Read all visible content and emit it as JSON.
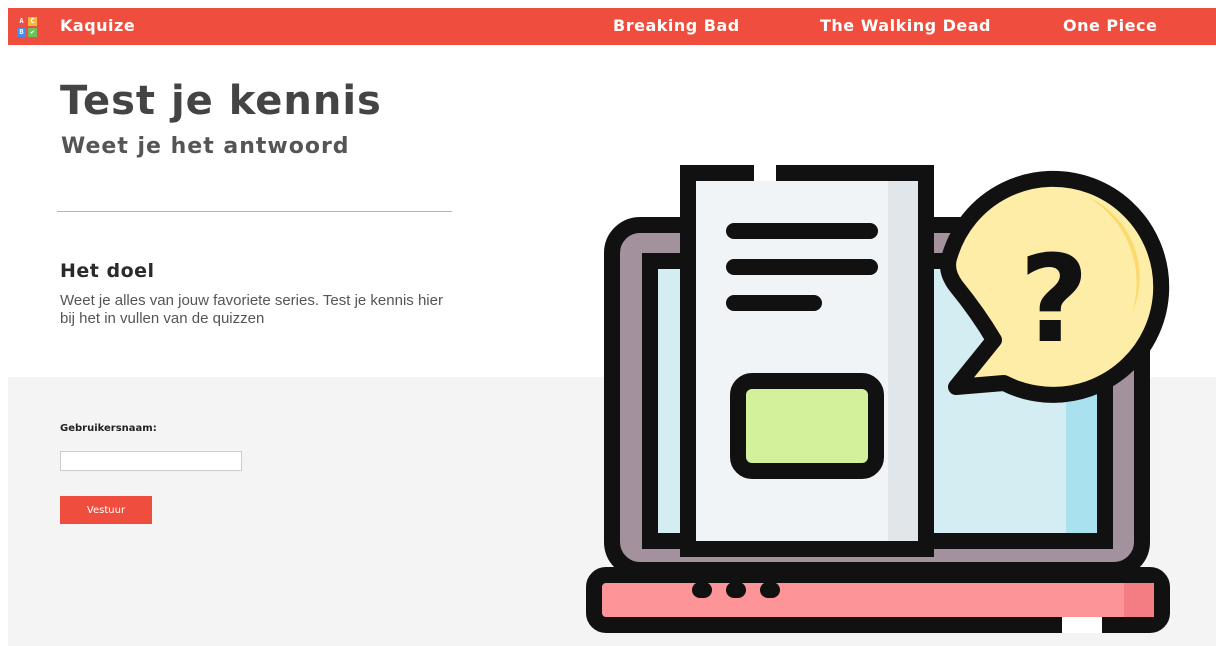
{
  "nav": {
    "brand": "Kaquize",
    "links": [
      "Breaking Bad",
      "The Walking Dead",
      "One Piece"
    ],
    "logo_letters": [
      "A",
      "C",
      "B",
      "✔"
    ],
    "colors": {
      "bar": "#ef4e3e"
    }
  },
  "hero": {
    "title": "Test je kennis",
    "subtitle": "Weet je het antwoord"
  },
  "goal": {
    "heading": "Het doel",
    "text": "Weet je alles van jouw favoriete series. Test je kennis hier bij het in vullen van de quizzen"
  },
  "form": {
    "username_label": "Gebruikersnaam:",
    "username_value": "",
    "submit_label": "Vestuur"
  },
  "illustration": {
    "icon": "laptop-quiz-illustration",
    "symbol": "?"
  }
}
